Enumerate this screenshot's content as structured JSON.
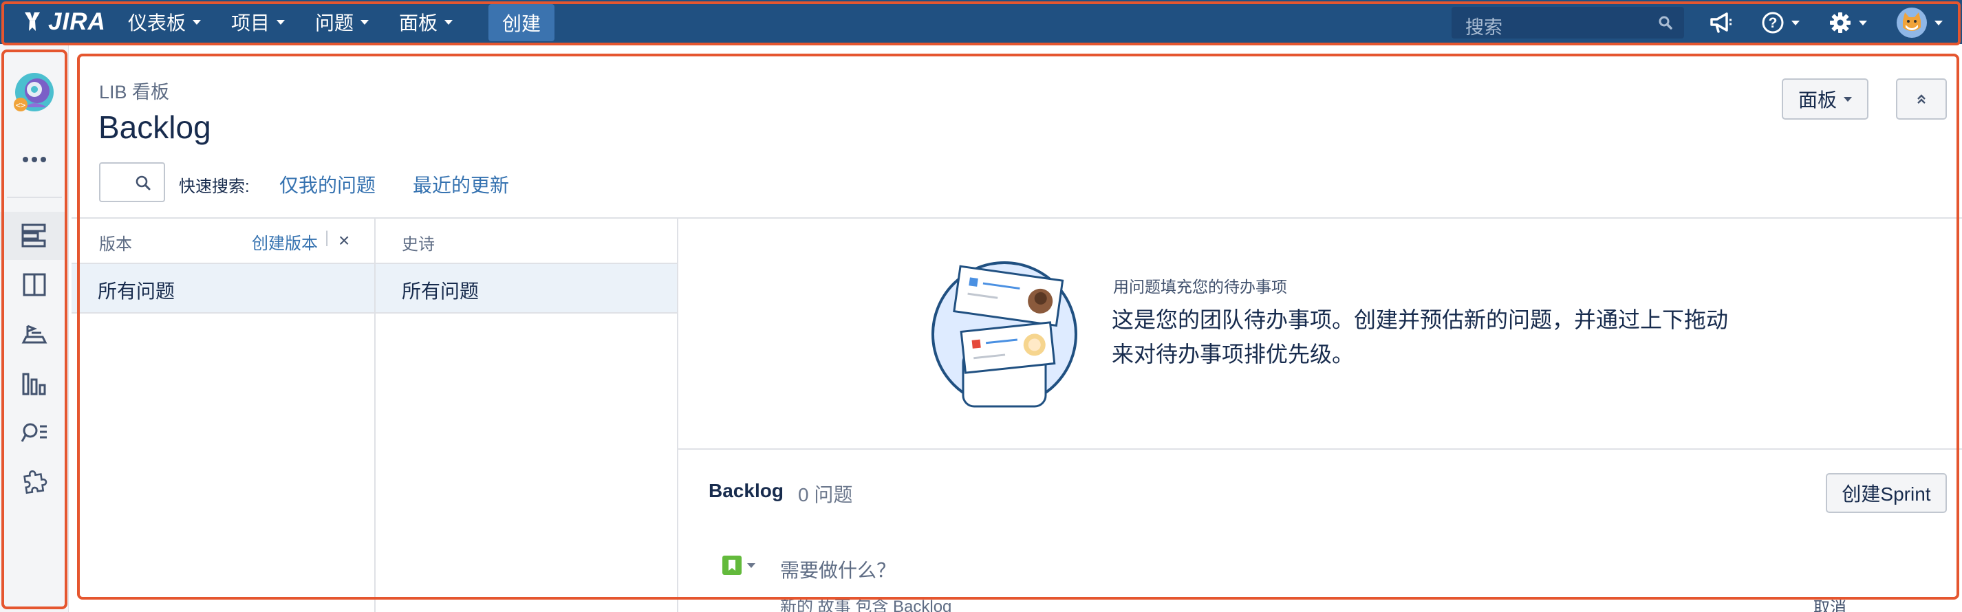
{
  "app": {
    "logo_text": "JIRA",
    "colors": {
      "nav_bg": "#205081",
      "create_bg": "#3b73af",
      "link": "#3572b0",
      "highlight": "#e5562f"
    }
  },
  "topnav": {
    "items": [
      {
        "label": "仪表板"
      },
      {
        "label": "项目"
      },
      {
        "label": "问题"
      },
      {
        "label": "面板"
      }
    ],
    "create_label": "创建",
    "search": {
      "placeholder": "搜索"
    },
    "icons": [
      "megaphone-icon",
      "help-icon",
      "gear-icon",
      "avatar"
    ]
  },
  "sidebar": {
    "items": [
      "project-avatar",
      "more-icon",
      "backlog-icon",
      "board-icon",
      "releases-icon",
      "reports-icon",
      "issues-search-icon",
      "addons-icon"
    ]
  },
  "header": {
    "breadcrumb": "LIB 看板",
    "title": "Backlog",
    "board_button": "面板"
  },
  "quick_search": {
    "label": "快速搜索:",
    "filters": [
      "仅我的问题",
      "最近的更新"
    ]
  },
  "versions_panel": {
    "title": "版本",
    "create_link": "创建版本",
    "separator": "|",
    "close": "×",
    "items": [
      "所有问题"
    ]
  },
  "epics_panel": {
    "title": "史诗",
    "items": [
      "所有问题"
    ]
  },
  "empty_state": {
    "title": "用问题填充您的待办事项",
    "text": "这是您的团队待办事项。创建并预估新的问题，并通过上下拖动来对待办事项排优先级。"
  },
  "backlog": {
    "title": "Backlog",
    "count": "0 问题",
    "create_sprint": "创建Sprint",
    "input_placeholder": "需要做什么？",
    "hint": "新的 故事 包含 Backlog",
    "cancel": "取消"
  }
}
